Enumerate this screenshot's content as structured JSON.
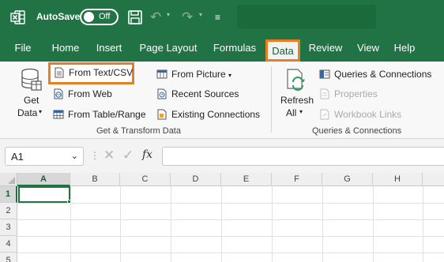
{
  "titlebar": {
    "autosave_label": "AutoSave",
    "autosave_state": "Off"
  },
  "tabs": [
    "File",
    "Home",
    "Insert",
    "Page Layout",
    "Formulas",
    "Data",
    "Review",
    "View",
    "Help"
  ],
  "active_tab": "Data",
  "ribbon": {
    "get_data_line1": "Get",
    "get_data_line2": "Data",
    "from_text_csv": "From Text/CSV",
    "from_web": "From Web",
    "from_table_range": "From Table/Range",
    "from_picture": "From Picture",
    "recent_sources": "Recent Sources",
    "existing_connections": "Existing Connections",
    "group1_label": "Get & Transform Data",
    "refresh_line1": "Refresh",
    "refresh_line2": "All",
    "queries_connections": "Queries & Connections",
    "properties": "Properties",
    "workbook_links": "Workbook Links",
    "group2_label": "Queries & Connections"
  },
  "formula_bar": {
    "name_box_value": "A1",
    "formula_value": ""
  },
  "grid": {
    "columns": [
      "A",
      "B",
      "C",
      "D",
      "E",
      "F",
      "G",
      "H"
    ],
    "rows": [
      "1",
      "2",
      "3",
      "4",
      "5"
    ],
    "selected_cell": "A1"
  },
  "colors": {
    "excel_green": "#217346",
    "highlight_orange": "#e67e22"
  }
}
